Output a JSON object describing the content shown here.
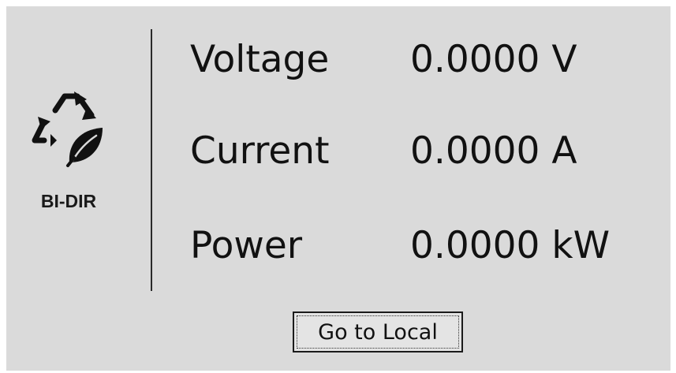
{
  "mode": {
    "label": "BI-DIR",
    "icon": "recycle-leaf-icon"
  },
  "readings": [
    {
      "label": "Voltage",
      "value": "0.0000 V"
    },
    {
      "label": "Current",
      "value": "0.0000 A"
    },
    {
      "label": "Power",
      "value": "0.0000 kW"
    }
  ],
  "button": {
    "label": "Go to Local"
  },
  "colors": {
    "panel_background": "#dadada",
    "text": "#111111"
  }
}
